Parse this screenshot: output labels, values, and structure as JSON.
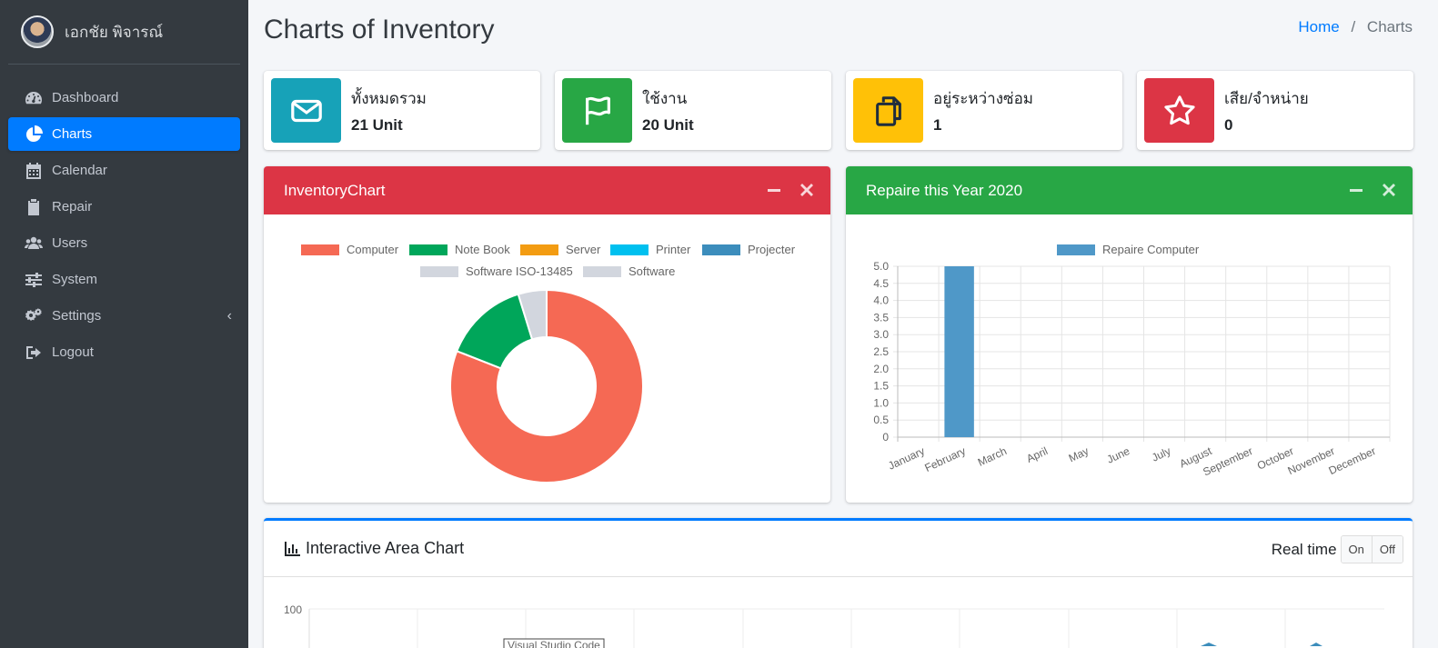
{
  "sidebar": {
    "user_name": "เอกชัย พิจารณ์",
    "items": [
      {
        "label": "Dashboard",
        "icon": "dashboard-icon"
      },
      {
        "label": "Charts",
        "icon": "pie-chart-icon",
        "active": true
      },
      {
        "label": "Calendar",
        "icon": "calendar-icon"
      },
      {
        "label": "Repair",
        "icon": "clipboard-icon"
      },
      {
        "label": "Users",
        "icon": "users-icon"
      },
      {
        "label": "System",
        "icon": "sliders-icon"
      },
      {
        "label": "Settings",
        "icon": "gears-icon",
        "caret": "‹"
      },
      {
        "label": "Logout",
        "icon": "sign-out-icon"
      }
    ]
  },
  "header": {
    "title": "Charts of Inventory",
    "breadcrumb": {
      "home": "Home",
      "separator": "/",
      "current": "Charts"
    }
  },
  "info_boxes": [
    {
      "label": "ทั้งหมดรวม",
      "value": "21 Unit",
      "color": "#17a2b8",
      "icon": "envelope-icon"
    },
    {
      "label": "ใช้งาน",
      "value": "20 Unit",
      "color": "#28a745",
      "icon": "flag-icon"
    },
    {
      "label": "อยู่ระหว่างซ่อม",
      "value": "1",
      "color": "#ffc107",
      "icon": "copy-icon"
    },
    {
      "label": "เสีย/จำหน่าย",
      "value": "0",
      "color": "#dc3545",
      "icon": "star-icon"
    }
  ],
  "inventory_card": {
    "title": "InventoryChart",
    "header_color": "#dc3545"
  },
  "repair_card": {
    "title": "Repaire this Year 2020",
    "header_color": "#28a745"
  },
  "area_card": {
    "title": "Interactive Area Chart",
    "realtime_label": "Real time",
    "on_label": "On",
    "off_label": "Off",
    "y_top_label": "100",
    "tooltip_text": "Visual Studio Code"
  },
  "chart_data": [
    {
      "type": "pie",
      "title": "",
      "labels": [
        "Computer",
        "Note Book",
        "Server",
        "Printer",
        "Projecter",
        "Software ISO-13485",
        "Software"
      ],
      "values": [
        17,
        3,
        0,
        0,
        0,
        1,
        0
      ],
      "colors": [
        "#f56954",
        "#00a65a",
        "#f39c12",
        "#00c0ef",
        "#3c8dbc",
        "#d2d6de",
        "#d2d6de"
      ],
      "legend": "top"
    },
    {
      "type": "bar",
      "title": "",
      "categories": [
        "January",
        "February",
        "March",
        "April",
        "May",
        "June",
        "July",
        "August",
        "September",
        "October",
        "November",
        "December"
      ],
      "series": [
        {
          "name": "Repaire Computer",
          "values": [
            0,
            5,
            0,
            0,
            0,
            0,
            0,
            0,
            0,
            0,
            0,
            0
          ],
          "color": "#4f98c8"
        }
      ],
      "y_ticks": [
        "0",
        "0.5",
        "1.0",
        "1.5",
        "2.0",
        "2.5",
        "3.0",
        "3.5",
        "4.0",
        "4.5",
        "5.0"
      ],
      "ylim": [
        0,
        5
      ],
      "grid": true,
      "legend": "top"
    }
  ]
}
